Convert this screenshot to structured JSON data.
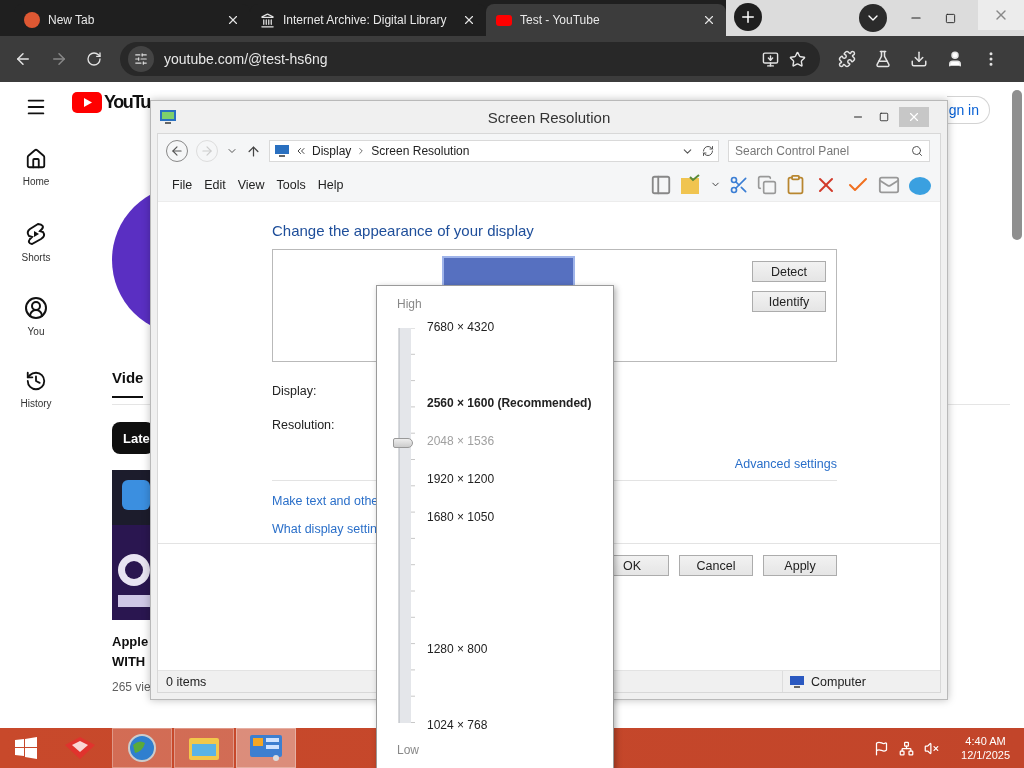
{
  "browser": {
    "tabs": [
      {
        "title": "New Tab",
        "selected": false
      },
      {
        "title": "Internet Archive: Digital Library",
        "selected": false
      },
      {
        "title": "Test - YouTube",
        "selected": true
      }
    ],
    "url": "youtube.com/@test-hs6ng"
  },
  "youtube": {
    "logo": "YouTu",
    "sign_in": "gn in",
    "nav": [
      {
        "label": "Home"
      },
      {
        "label": "Shorts"
      },
      {
        "label": "You"
      },
      {
        "label": "History"
      }
    ],
    "section_tab": "Vide",
    "chip": "Late",
    "video": {
      "title_lines": [
        "Apple",
        "WITH"
      ],
      "meta": "265 vie"
    }
  },
  "dialog": {
    "title": "Screen Resolution",
    "breadcrumb": [
      "Display",
      "Screen Resolution"
    ],
    "search_placeholder": "Search Control Panel",
    "menu": [
      "File",
      "Edit",
      "View",
      "Tools",
      "Help"
    ],
    "heading": "Change the appearance of your display",
    "monitor_buttons": [
      "Detect",
      "Identify"
    ],
    "labels": [
      "Display:",
      "Resolution:"
    ],
    "advanced_link": "Advanced settings",
    "links": [
      "Make text and othe",
      "What display settin"
    ],
    "buttons": [
      "OK",
      "Cancel",
      "Apply"
    ],
    "status": {
      "items": "0 items",
      "location": "Computer"
    }
  },
  "resolution_menu": {
    "high": "High",
    "low": "Low",
    "level": 0.71,
    "options": [
      {
        "label": "7680 × 4320",
        "recommended": false,
        "selected": false
      },
      {
        "label": "2560 × 1600 (Recommended)",
        "recommended": true,
        "selected": false
      },
      {
        "label": "2048 × 1536",
        "recommended": false,
        "selected": true
      },
      {
        "label": "1920 × 1200",
        "recommended": false,
        "selected": false
      },
      {
        "label": "1680 × 1050",
        "recommended": false,
        "selected": false
      },
      {
        "label": "1280 × 800",
        "recommended": false,
        "selected": false
      },
      {
        "label": "1024 × 768",
        "recommended": false,
        "selected": false
      }
    ]
  },
  "taskbar": {
    "apps": [
      {
        "running": false,
        "selected": false
      },
      {
        "running": true,
        "selected": false
      },
      {
        "running": true,
        "selected": false
      },
      {
        "running": true,
        "selected": true
      }
    ],
    "time": "4:40 AM",
    "date": "12/1/2025"
  }
}
